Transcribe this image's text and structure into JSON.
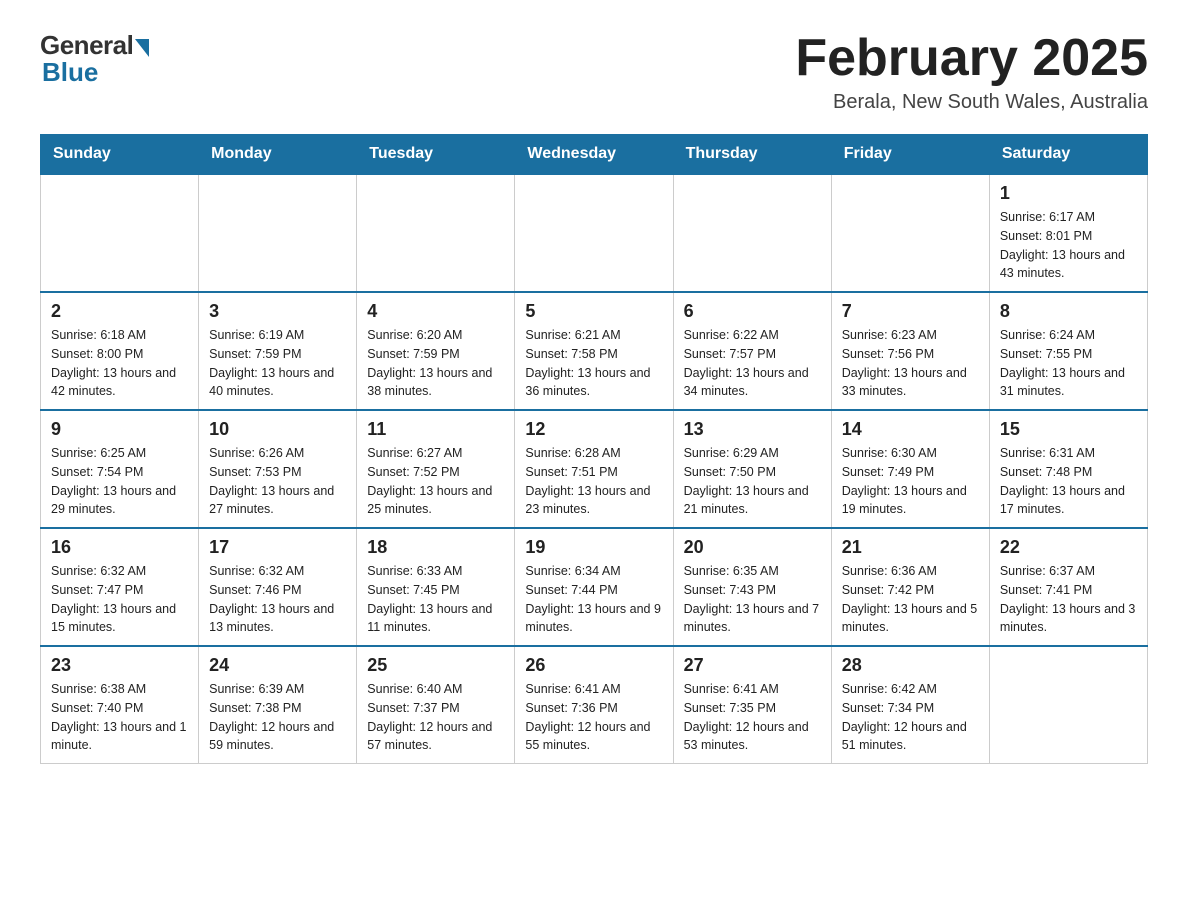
{
  "header": {
    "logo": {
      "general": "General",
      "blue": "Blue"
    },
    "title": "February 2025",
    "location": "Berala, New South Wales, Australia"
  },
  "calendar": {
    "days_of_week": [
      "Sunday",
      "Monday",
      "Tuesday",
      "Wednesday",
      "Thursday",
      "Friday",
      "Saturday"
    ],
    "weeks": [
      [
        {
          "day": "",
          "info": ""
        },
        {
          "day": "",
          "info": ""
        },
        {
          "day": "",
          "info": ""
        },
        {
          "day": "",
          "info": ""
        },
        {
          "day": "",
          "info": ""
        },
        {
          "day": "",
          "info": ""
        },
        {
          "day": "1",
          "info": "Sunrise: 6:17 AM\nSunset: 8:01 PM\nDaylight: 13 hours and 43 minutes."
        }
      ],
      [
        {
          "day": "2",
          "info": "Sunrise: 6:18 AM\nSunset: 8:00 PM\nDaylight: 13 hours and 42 minutes."
        },
        {
          "day": "3",
          "info": "Sunrise: 6:19 AM\nSunset: 7:59 PM\nDaylight: 13 hours and 40 minutes."
        },
        {
          "day": "4",
          "info": "Sunrise: 6:20 AM\nSunset: 7:59 PM\nDaylight: 13 hours and 38 minutes."
        },
        {
          "day": "5",
          "info": "Sunrise: 6:21 AM\nSunset: 7:58 PM\nDaylight: 13 hours and 36 minutes."
        },
        {
          "day": "6",
          "info": "Sunrise: 6:22 AM\nSunset: 7:57 PM\nDaylight: 13 hours and 34 minutes."
        },
        {
          "day": "7",
          "info": "Sunrise: 6:23 AM\nSunset: 7:56 PM\nDaylight: 13 hours and 33 minutes."
        },
        {
          "day": "8",
          "info": "Sunrise: 6:24 AM\nSunset: 7:55 PM\nDaylight: 13 hours and 31 minutes."
        }
      ],
      [
        {
          "day": "9",
          "info": "Sunrise: 6:25 AM\nSunset: 7:54 PM\nDaylight: 13 hours and 29 minutes."
        },
        {
          "day": "10",
          "info": "Sunrise: 6:26 AM\nSunset: 7:53 PM\nDaylight: 13 hours and 27 minutes."
        },
        {
          "day": "11",
          "info": "Sunrise: 6:27 AM\nSunset: 7:52 PM\nDaylight: 13 hours and 25 minutes."
        },
        {
          "day": "12",
          "info": "Sunrise: 6:28 AM\nSunset: 7:51 PM\nDaylight: 13 hours and 23 minutes."
        },
        {
          "day": "13",
          "info": "Sunrise: 6:29 AM\nSunset: 7:50 PM\nDaylight: 13 hours and 21 minutes."
        },
        {
          "day": "14",
          "info": "Sunrise: 6:30 AM\nSunset: 7:49 PM\nDaylight: 13 hours and 19 minutes."
        },
        {
          "day": "15",
          "info": "Sunrise: 6:31 AM\nSunset: 7:48 PM\nDaylight: 13 hours and 17 minutes."
        }
      ],
      [
        {
          "day": "16",
          "info": "Sunrise: 6:32 AM\nSunset: 7:47 PM\nDaylight: 13 hours and 15 minutes."
        },
        {
          "day": "17",
          "info": "Sunrise: 6:32 AM\nSunset: 7:46 PM\nDaylight: 13 hours and 13 minutes."
        },
        {
          "day": "18",
          "info": "Sunrise: 6:33 AM\nSunset: 7:45 PM\nDaylight: 13 hours and 11 minutes."
        },
        {
          "day": "19",
          "info": "Sunrise: 6:34 AM\nSunset: 7:44 PM\nDaylight: 13 hours and 9 minutes."
        },
        {
          "day": "20",
          "info": "Sunrise: 6:35 AM\nSunset: 7:43 PM\nDaylight: 13 hours and 7 minutes."
        },
        {
          "day": "21",
          "info": "Sunrise: 6:36 AM\nSunset: 7:42 PM\nDaylight: 13 hours and 5 minutes."
        },
        {
          "day": "22",
          "info": "Sunrise: 6:37 AM\nSunset: 7:41 PM\nDaylight: 13 hours and 3 minutes."
        }
      ],
      [
        {
          "day": "23",
          "info": "Sunrise: 6:38 AM\nSunset: 7:40 PM\nDaylight: 13 hours and 1 minute."
        },
        {
          "day": "24",
          "info": "Sunrise: 6:39 AM\nSunset: 7:38 PM\nDaylight: 12 hours and 59 minutes."
        },
        {
          "day": "25",
          "info": "Sunrise: 6:40 AM\nSunset: 7:37 PM\nDaylight: 12 hours and 57 minutes."
        },
        {
          "day": "26",
          "info": "Sunrise: 6:41 AM\nSunset: 7:36 PM\nDaylight: 12 hours and 55 minutes."
        },
        {
          "day": "27",
          "info": "Sunrise: 6:41 AM\nSunset: 7:35 PM\nDaylight: 12 hours and 53 minutes."
        },
        {
          "day": "28",
          "info": "Sunrise: 6:42 AM\nSunset: 7:34 PM\nDaylight: 12 hours and 51 minutes."
        },
        {
          "day": "",
          "info": ""
        }
      ]
    ]
  }
}
